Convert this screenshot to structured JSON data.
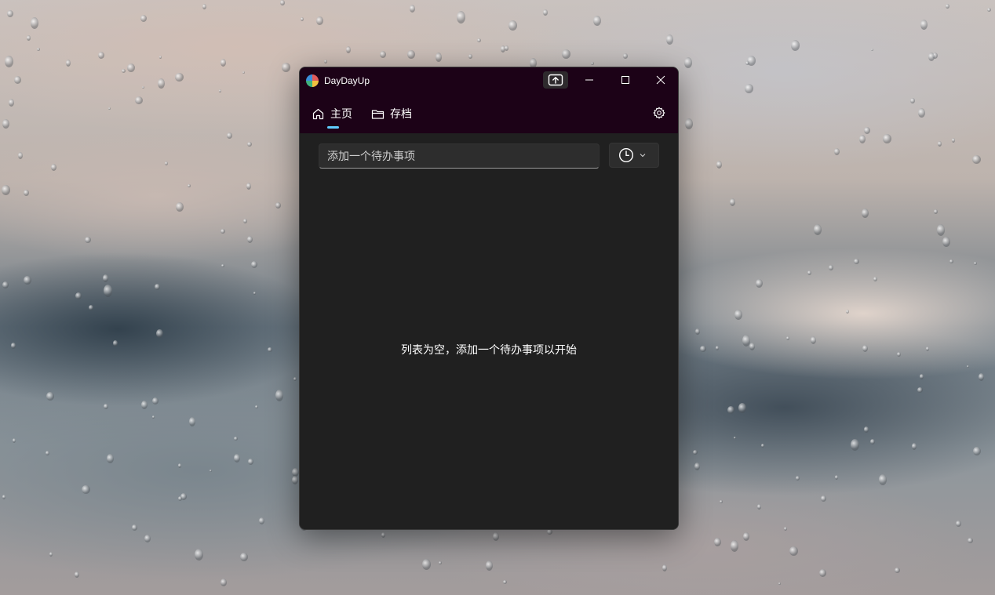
{
  "window": {
    "title": "DayDayUp"
  },
  "nav": {
    "items": [
      {
        "label": "主页",
        "icon": "home-icon",
        "selected": true
      },
      {
        "label": "存档",
        "icon": "folder-icon",
        "selected": false
      }
    ],
    "settings_icon": "gear-icon"
  },
  "toolbar": {
    "pin_icon": "upload-icon"
  },
  "main": {
    "input_placeholder": "添加一个待办事项",
    "time_icon": "clock-icon",
    "empty_message": "列表为空，添加一个待办事项以开始"
  },
  "colors": {
    "titlebar_bg": "#1c0217",
    "content_bg": "#202020",
    "accent": "#60cdff"
  }
}
